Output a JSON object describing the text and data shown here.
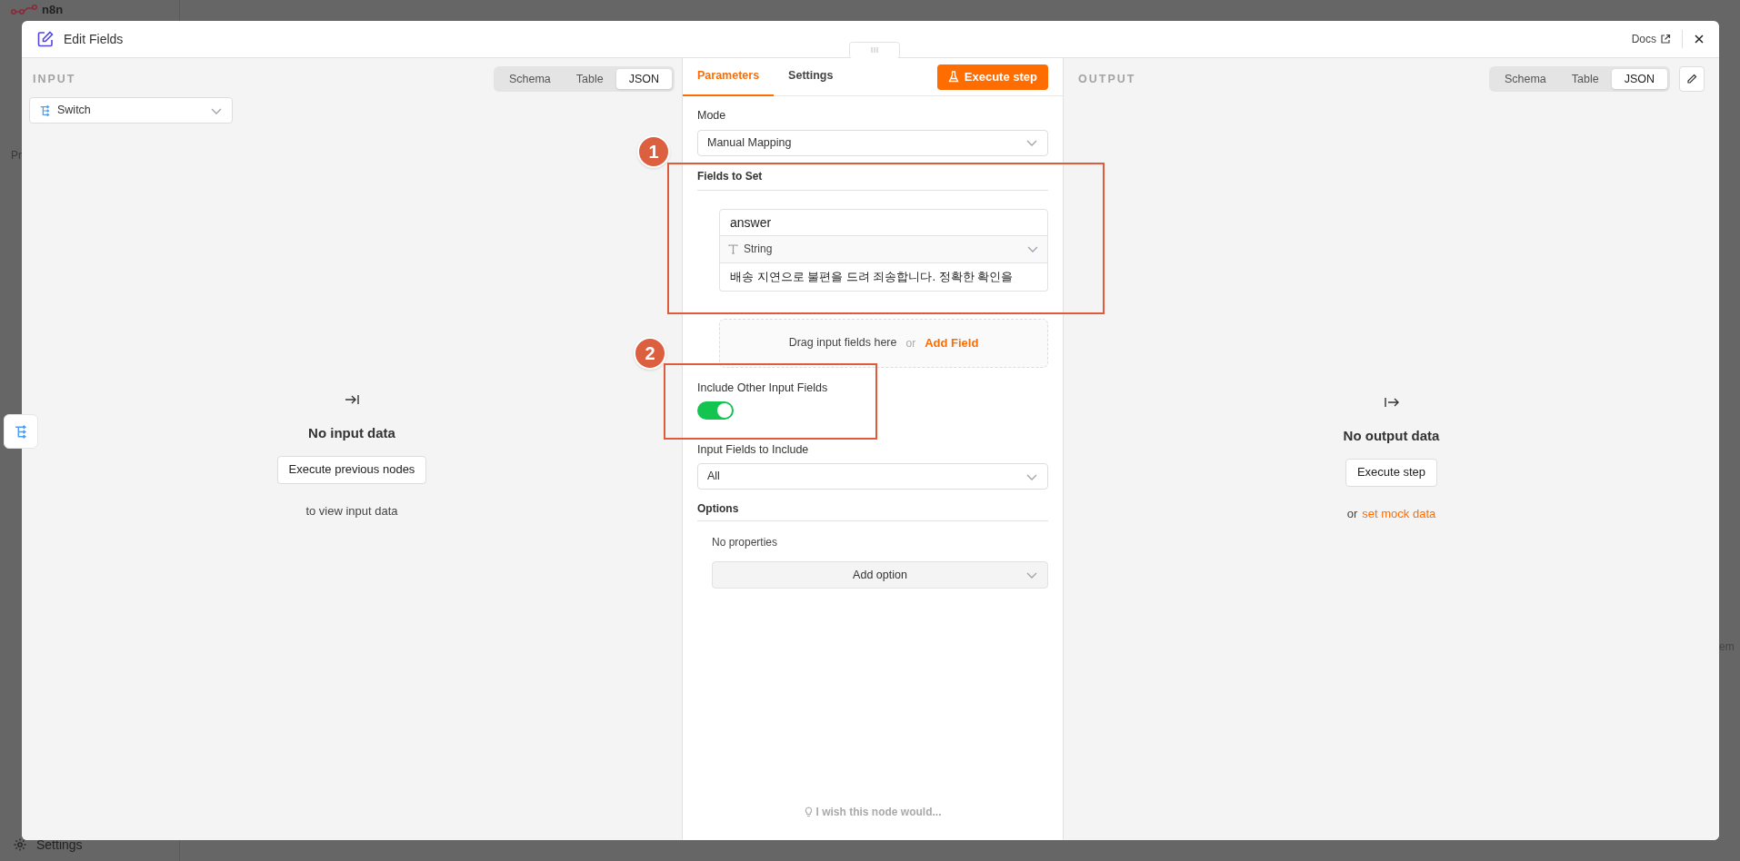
{
  "background": {
    "logo": "n8n",
    "section_label": "Pr",
    "settings_label": "Settings",
    "right_fragment": "em"
  },
  "window": {
    "title": "Edit Fields",
    "docs_link": "Docs"
  },
  "input": {
    "heading": "INPUT",
    "view_tabs": [
      {
        "label": "Schema",
        "selected": false
      },
      {
        "label": "Table",
        "selected": false
      },
      {
        "label": "JSON",
        "selected": true
      }
    ],
    "node_select": "Switch",
    "empty_title": "No input data",
    "empty_button": "Execute previous nodes",
    "empty_hint": "to view input data"
  },
  "parameters": {
    "tabs": [
      {
        "label": "Parameters",
        "selected": true
      },
      {
        "label": "Settings",
        "selected": false
      }
    ],
    "execute_button": "Execute step",
    "mode": {
      "label": "Mode",
      "value": "Manual Mapping"
    },
    "fields_to_set": {
      "label": "Fields to Set",
      "fields": [
        {
          "name": "answer",
          "type": "String",
          "value": "배송 지연으로 불편을 드려 죄송합니다. 정확한 확인을"
        }
      ],
      "drop_hint": "Drag input fields here",
      "drop_or": "or",
      "add_field": "Add Field"
    },
    "include_other": {
      "label": "Include Other Input Fields",
      "on": true
    },
    "input_fields": {
      "label": "Input Fields to Include",
      "value": "All"
    },
    "options": {
      "label": "Options",
      "empty": "No properties",
      "add_button": "Add option"
    },
    "feedback": "I wish this node would..."
  },
  "output": {
    "heading": "OUTPUT",
    "view_tabs": [
      {
        "label": "Schema",
        "selected": false
      },
      {
        "label": "Table",
        "selected": false
      },
      {
        "label": "JSON",
        "selected": true
      }
    ],
    "empty_title": "No output data",
    "empty_button": "Execute step",
    "hint_prefix": "or",
    "hint_link": "set mock data"
  },
  "annotations": [
    {
      "label": "1"
    },
    {
      "label": "2"
    }
  ]
}
